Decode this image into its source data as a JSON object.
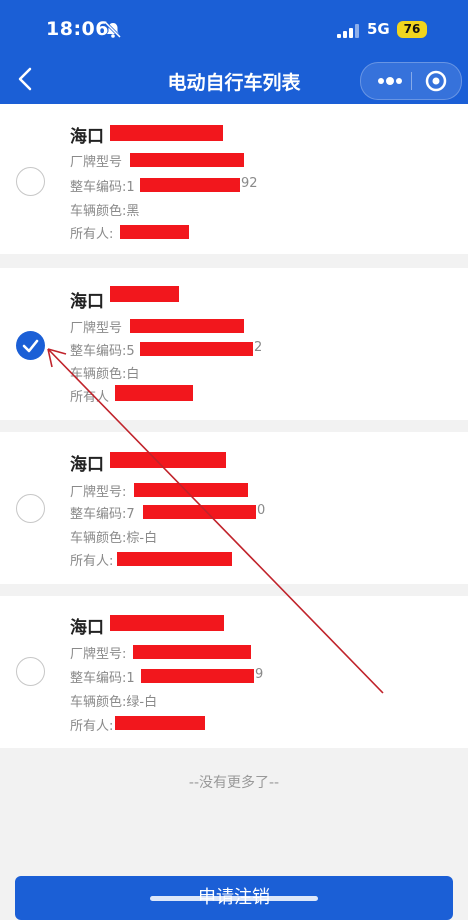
{
  "status_bar": {
    "time": "18:06",
    "network": "5G",
    "battery": "76"
  },
  "nav": {
    "title": "电动自行车列表"
  },
  "vehicles": [
    {
      "plate": "海口",
      "brand_label": "厂牌型号",
      "code_label": "整车编码:1",
      "code_tail": "92",
      "color_label": "车辆颜色:黑",
      "owner_label": "所有人:",
      "selected": false
    },
    {
      "plate": "海口",
      "brand_label": "厂牌型号",
      "code_label": "整车编码:5",
      "code_tail": "2",
      "color_label": "车辆颜色:白",
      "owner_label": "所有人",
      "selected": true
    },
    {
      "plate": "海口",
      "brand_label": "厂牌型号:",
      "code_label": "整车编码:7",
      "code_tail": "0",
      "color_label": "车辆颜色:棕-白",
      "owner_label": "所有人:",
      "selected": false
    },
    {
      "plate": "海口",
      "brand_label": "厂牌型号:",
      "code_label": "整车编码:1",
      "code_tail": "9",
      "color_label": "车辆颜色:绿-白",
      "owner_label": "所有人:",
      "selected": false
    }
  ],
  "footer": {
    "no_more": "--没有更多了--",
    "submit_label": "申请注销"
  },
  "colors": {
    "primary": "#1b5fd6",
    "redaction": "#f2171d",
    "annotation_arrow": "#c0232b"
  }
}
